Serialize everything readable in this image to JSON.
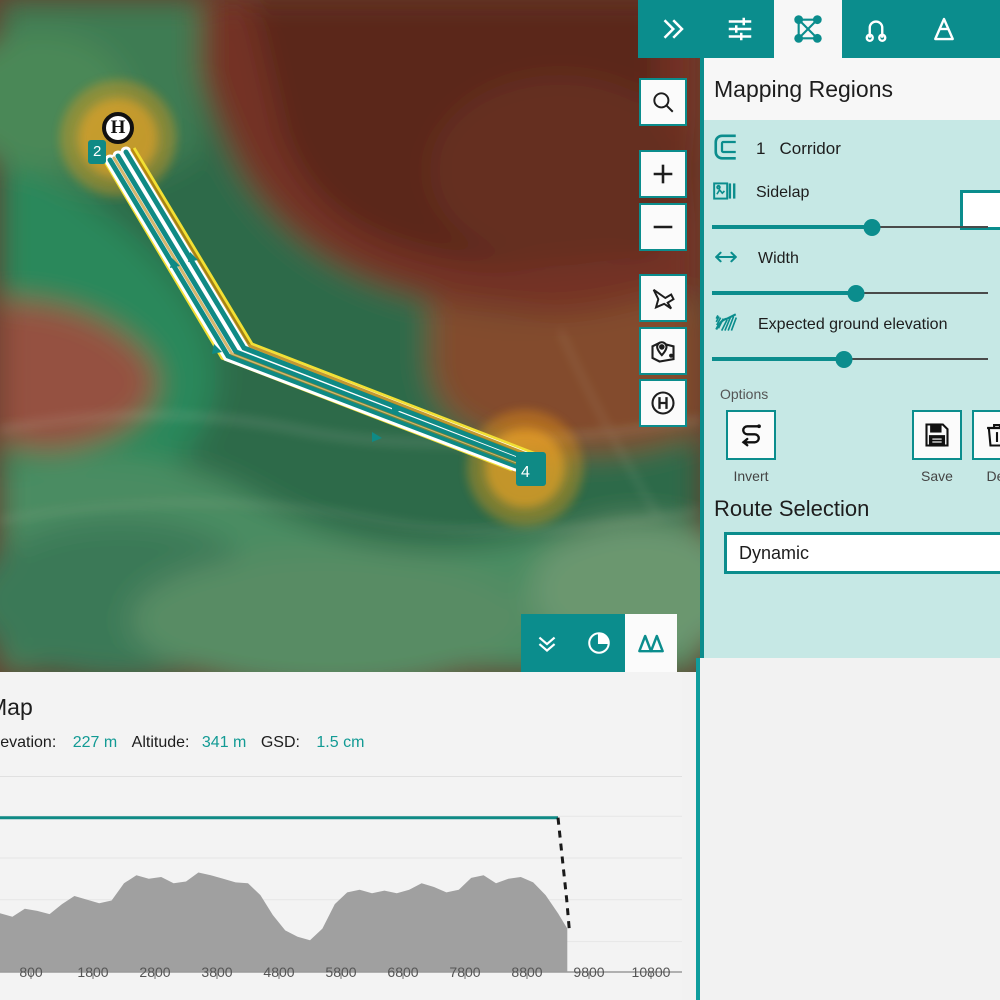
{
  "top_toolbar": {
    "buttons": [
      {
        "name": "expand-chevrons-icon",
        "label": "Expand",
        "active": false
      },
      {
        "name": "sliders-settings-icon",
        "label": "Settings",
        "active": false
      },
      {
        "name": "mission-nodes-icon",
        "label": "Mapping Regions",
        "active": true
      },
      {
        "name": "structure-scan-icon",
        "label": "Structure Scan",
        "active": false
      },
      {
        "name": "traffic-cone-icon",
        "label": "Obstacles",
        "active": false
      }
    ]
  },
  "map": {
    "controls": [
      {
        "name": "search-icon",
        "label": "Search"
      },
      {
        "name": "zoom-in-icon",
        "label": "+"
      },
      {
        "name": "zoom-out-icon",
        "label": "−"
      },
      {
        "name": "drone-icon",
        "label": "Center on drone"
      },
      {
        "name": "map-pin-icon",
        "label": "Center on map"
      },
      {
        "name": "home-icon",
        "label": "Center on home"
      }
    ],
    "bottom_bar": [
      {
        "name": "collapse-chevrons-icon",
        "label": "Collapse",
        "active": false
      },
      {
        "name": "pie-chart-icon",
        "label": "Statistics",
        "active": false
      },
      {
        "name": "terrain-elevation-icon",
        "label": "Elevation",
        "active": true
      }
    ],
    "markers": {
      "home_label": "H",
      "start_waypoint": "2",
      "end_waypoint": "4"
    }
  },
  "panel": {
    "title": "Mapping Regions",
    "region": {
      "icon": "corridor-icon",
      "index": "1",
      "label": "Corridor",
      "value": ""
    },
    "controls": [
      {
        "icon": "sidelap-icon",
        "label": "Sidelap",
        "value": 58
      },
      {
        "icon": "width-arrows-icon",
        "label": "Width",
        "value": 52
      },
      {
        "icon": "ground-elevation-icon",
        "label": "Expected ground elevation",
        "value": 48
      }
    ],
    "options_label": "Options",
    "options": [
      {
        "icon": "invert-route-icon",
        "label": "Invert"
      },
      {
        "icon": "save-disk-icon",
        "label": "Save"
      },
      {
        "icon": "delete-trash-icon",
        "label": "Del"
      }
    ],
    "route_selection": {
      "title": "Route Selection",
      "selected": "Dynamic"
    }
  },
  "chart_panel": {
    "title": "Map",
    "stats": [
      {
        "key": "Elevation:",
        "value": "227 m"
      },
      {
        "key": "Altitude:",
        "value": "341 m"
      },
      {
        "key": "GSD:",
        "value": "1.5 cm"
      }
    ]
  },
  "colors": {
    "accent": "#0b8d8d",
    "panel_bg": "#c6e8e5",
    "header_bg": "#f7f7f7",
    "stat_value": "#129a94",
    "terrain_fill": "#a0a0a0",
    "flight_line": "#0f8a85"
  },
  "chart_data": {
    "type": "area",
    "title": "Map",
    "xlabel": "",
    "ylabel": "",
    "xlim": [
      300,
      11300
    ],
    "ylim": [
      0,
      420
    ],
    "grid": true,
    "xticks": [
      800,
      1800,
      2800,
      3800,
      4800,
      5800,
      6800,
      7800,
      8800,
      9800,
      10800
    ],
    "xtick_labels": [
      "800",
      "1800",
      "2800",
      "3800",
      "4800",
      "5800",
      "6800",
      "7800",
      "8800",
      "9800",
      "10800"
    ],
    "series": [
      {
        "name": "Terrain elevation",
        "type": "area",
        "color": "#a0a0a0",
        "x": [
          300,
          500,
          700,
          900,
          1100,
          1300,
          1500,
          1700,
          1900,
          2100,
          2300,
          2500,
          2700,
          2900,
          3100,
          3300,
          3500,
          3700,
          3900,
          4100,
          4300,
          4500,
          4700,
          4900,
          5100,
          5300,
          5500,
          5700,
          5900,
          6100,
          6300,
          6500,
          6700,
          6900,
          7100,
          7300,
          7500,
          7700,
          7900,
          8100,
          8300,
          8500,
          8700,
          8900,
          9100,
          9300,
          9450
        ],
        "y": [
          130,
          122,
          140,
          135,
          128,
          150,
          168,
          160,
          152,
          158,
          196,
          214,
          206,
          210,
          196,
          200,
          220,
          214,
          206,
          198,
          196,
          170,
          126,
          92,
          78,
          70,
          96,
          150,
          176,
          182,
          174,
          180,
          174,
          182,
          196,
          188,
          176,
          182,
          208,
          214,
          196,
          206,
          210,
          198,
          170,
          130,
          96
        ]
      },
      {
        "name": "Planned flight path",
        "type": "line",
        "color": "#0f8a85",
        "x": [
          300,
          9300
        ],
        "y": [
          341,
          341
        ]
      },
      {
        "name": "Descent (landing)",
        "type": "dashed-line",
        "color": "#1a1a1a",
        "x": [
          9300,
          9440,
          9480
        ],
        "y": [
          341,
          160,
          96
        ]
      }
    ]
  }
}
